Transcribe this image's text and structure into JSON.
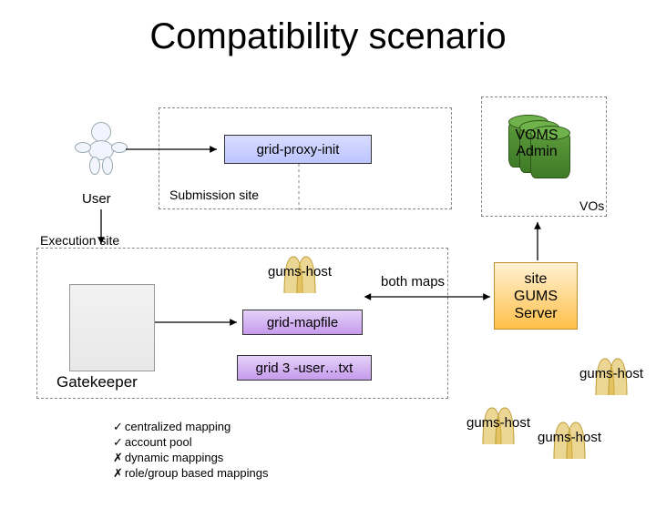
{
  "title": "Compatibility scenario",
  "submissionSite": {
    "label": "Submission site"
  },
  "executionSite": {
    "label": "Execution site"
  },
  "user": {
    "label": "User"
  },
  "gatekeeper": {
    "label": "Gatekeeper"
  },
  "boxes": {
    "gridProxyInit": "grid-proxy-init",
    "gridMapfile": "grid-mapfile",
    "grid3UserTxt": "grid 3 -user…txt"
  },
  "voms": {
    "line1": "VOMS",
    "line2": "Admin"
  },
  "vosLabel": "VOs",
  "bothMaps": "both maps",
  "gumsServer": {
    "line1": "site",
    "line2": "GUMS",
    "line3": "Server"
  },
  "gumsHost": "gums-host",
  "bullets": {
    "b1": "centralized mapping",
    "b2": "account pool",
    "b3": "dynamic mappings",
    "b4": "role/group based mappings"
  }
}
